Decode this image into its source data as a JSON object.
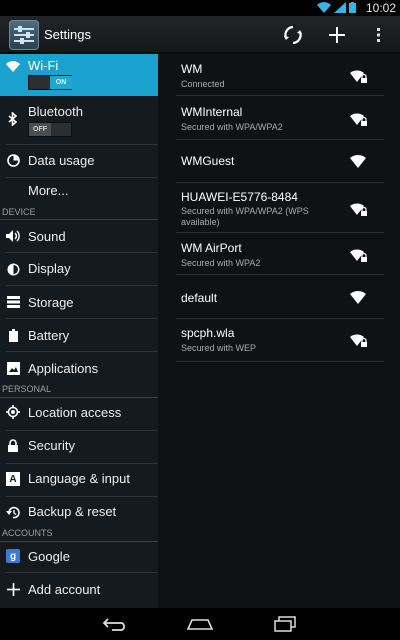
{
  "status_bar": {
    "time": "10:02"
  },
  "action_bar": {
    "title": "Settings"
  },
  "sidebar": {
    "wifi": {
      "label": "Wi-Fi",
      "toggle": "ON"
    },
    "bluetooth": {
      "label": "Bluetooth",
      "toggle": "OFF"
    },
    "items": [
      {
        "label": "Data usage"
      },
      {
        "label": "More..."
      }
    ],
    "device_header": "DEVICE",
    "device_items": [
      {
        "label": "Sound"
      },
      {
        "label": "Display"
      },
      {
        "label": "Storage"
      },
      {
        "label": "Battery"
      },
      {
        "label": "Applications"
      }
    ],
    "personal_header": "PERSONAL",
    "personal_items": [
      {
        "label": "Location access"
      },
      {
        "label": "Security"
      },
      {
        "label": "Language & input"
      },
      {
        "label": "Backup & reset"
      }
    ],
    "accounts_header": "ACCOUNTS",
    "accounts_items": [
      {
        "label": "Google"
      },
      {
        "label": "Add account"
      }
    ]
  },
  "networks": [
    {
      "name": "WM",
      "status": "Connected"
    },
    {
      "name": "WMInternal",
      "status": "Secured with WPA/WPA2"
    },
    {
      "name": "WMGuest",
      "status": ""
    },
    {
      "name": "HUAWEI-E5776-8484",
      "status": "Secured with WPA/WPA2 (WPS available)"
    },
    {
      "name": "WM AirPort",
      "status": "Secured with WPA2"
    },
    {
      "name": "default",
      "status": ""
    },
    {
      "name": "spcph.wla",
      "status": "Secured with WEP"
    }
  ],
  "colors": {
    "accent": "#1aa2cf",
    "on_text": "#8fd8f4"
  }
}
